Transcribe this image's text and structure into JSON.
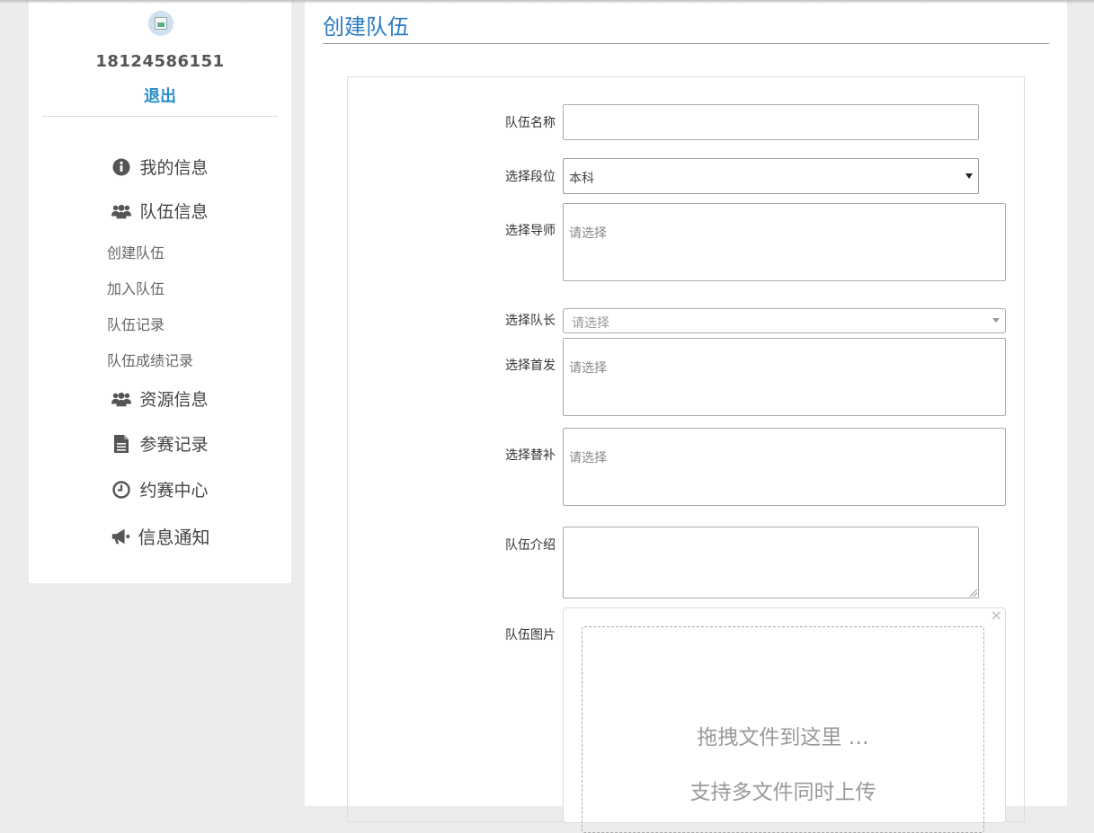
{
  "sidebar": {
    "phone": "18124586151",
    "logout_label": "退出",
    "menu": {
      "my_info": {
        "label": "我的信息",
        "icon": "info-circle-icon"
      },
      "team_info": {
        "label": "队伍信息",
        "icon": "users-icon"
      },
      "resource_info": {
        "label": "资源信息",
        "icon": "users-icon"
      },
      "competition_records": {
        "label": "参赛记录",
        "icon": "file-text-icon"
      },
      "match_center": {
        "label": "约赛中心",
        "icon": "clock-icon"
      },
      "notifications": {
        "label": "信息通知",
        "icon": "bullhorn-icon"
      }
    },
    "submenu": {
      "create_team": "创建队伍",
      "join_team": "加入队伍",
      "team_records": "队伍记录",
      "team_score_records": "队伍成绩记录"
    }
  },
  "main": {
    "title": "创建队伍",
    "form": {
      "team_name": {
        "label": "队伍名称",
        "value": ""
      },
      "segment": {
        "label": "选择段位",
        "value": "本科"
      },
      "mentor": {
        "label": "选择导师",
        "placeholder": "请选择"
      },
      "captain": {
        "label": "选择队长",
        "placeholder": "请选择"
      },
      "starters": {
        "label": "选择首发",
        "placeholder": "请选择"
      },
      "substitutes": {
        "label": "选择替补",
        "placeholder": "请选择"
      },
      "intro": {
        "label": "队伍介绍",
        "value": ""
      },
      "image": {
        "label": "队伍图片",
        "drop_text": "拖拽文件到这里 …",
        "multi_text": "支持多文件同时上传",
        "close_glyph": "×"
      }
    }
  }
}
